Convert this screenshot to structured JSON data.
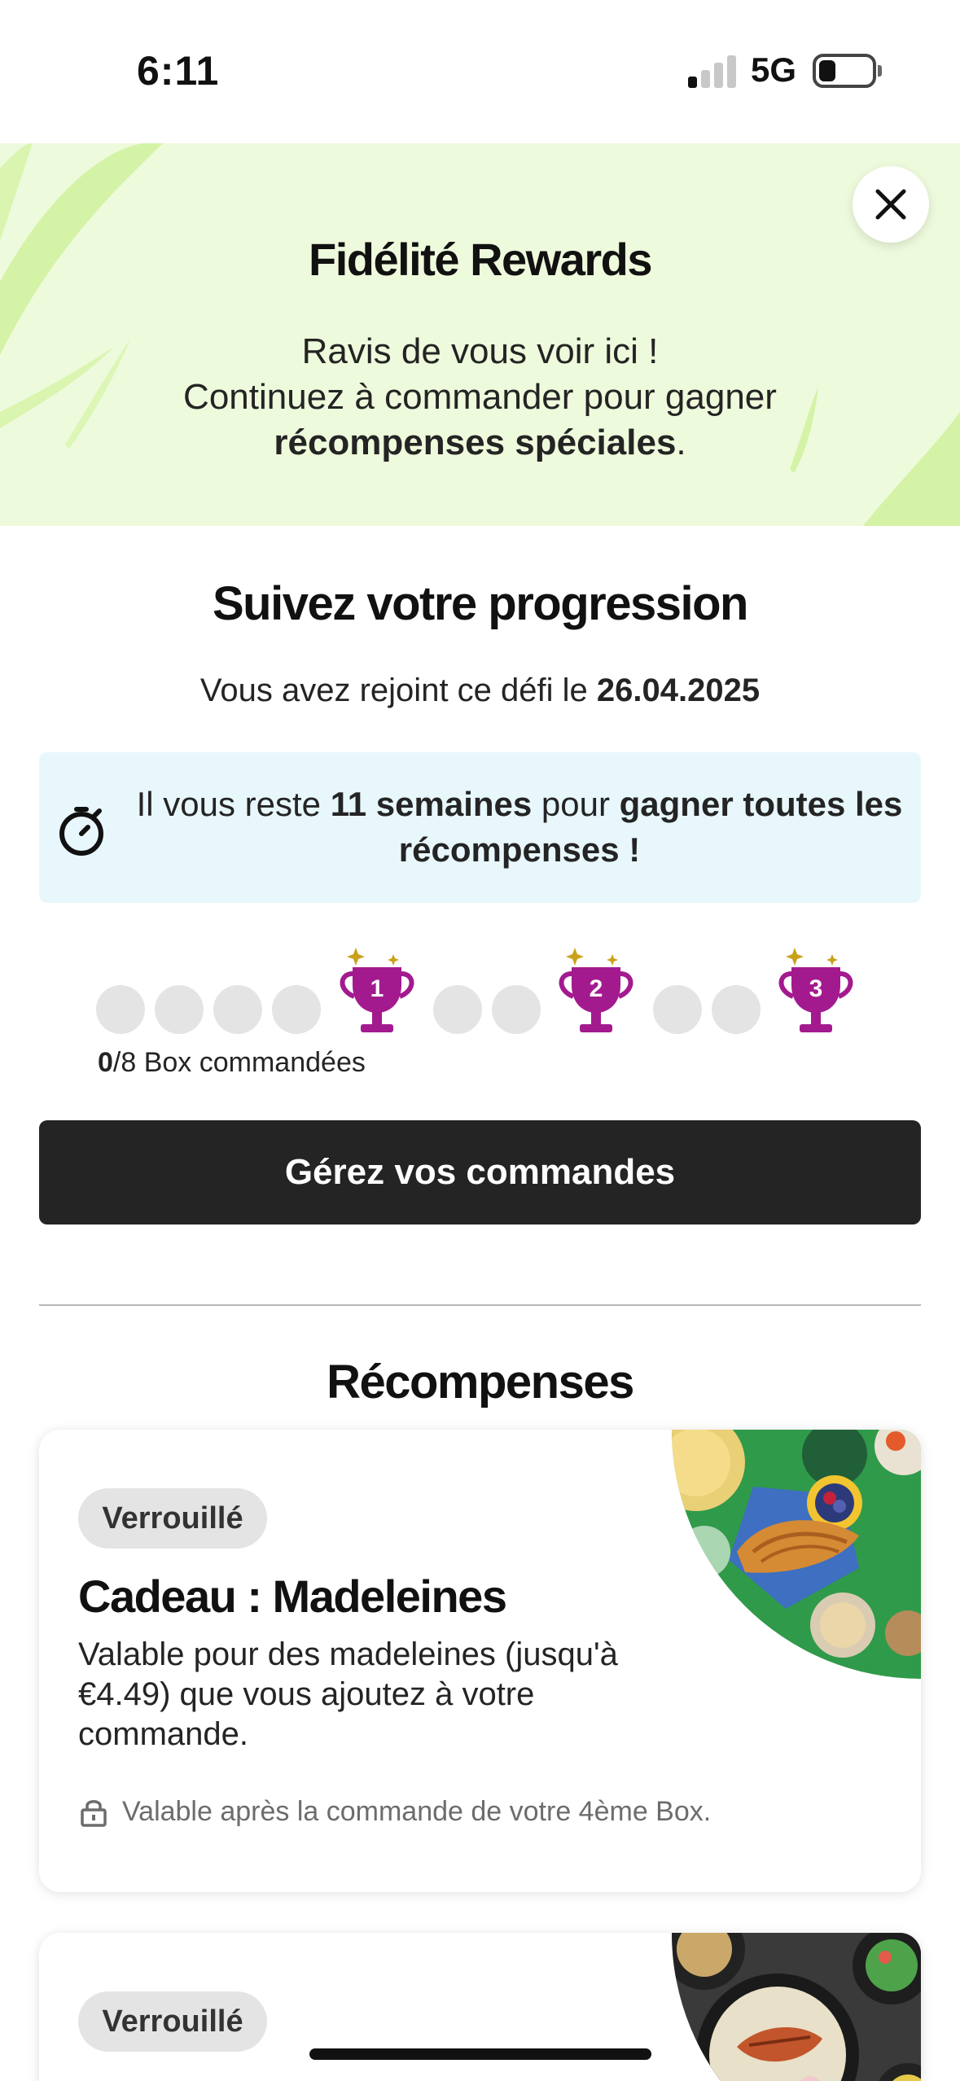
{
  "status_bar": {
    "time": "6:11",
    "network": "5G",
    "signal_bars_on": 1,
    "signal_bars_total": 4
  },
  "banner": {
    "title": "Fidélité Rewards",
    "line1": "Ravis de vous voir ici !",
    "line2": "Continuez à commander pour gagner",
    "line3_bold": "récompenses spéciales",
    "line3_end": ".",
    "bg_color": "#eefadc"
  },
  "progress": {
    "title": "Suivez votre progression",
    "joined_prefix": "Vous avez rejoint ce défi le ",
    "joined_date": "26.04.2025",
    "info_prefix": "Il vous reste ",
    "info_weeks": "11 semaines",
    "info_mid": " pour ",
    "info_goal": "gagner toutes les récompenses !",
    "trophies": [
      "1",
      "2",
      "3"
    ],
    "boxes_ordered": "0",
    "boxes_total_label": "/8 Box commandées",
    "trophy_color": "#a31a8f",
    "manage_button": "Gérez vos commandes"
  },
  "rewards": {
    "title": "Récompenses",
    "cards": [
      {
        "status": "Verrouillé",
        "title": "Cadeau : Madeleines",
        "description": "Valable pour des madeleines (jusqu'à €4.49) que vous ajoutez à votre commande.",
        "note": "Valable après la commande de votre 4ème Box."
      },
      {
        "status": "Verrouillé"
      }
    ]
  }
}
